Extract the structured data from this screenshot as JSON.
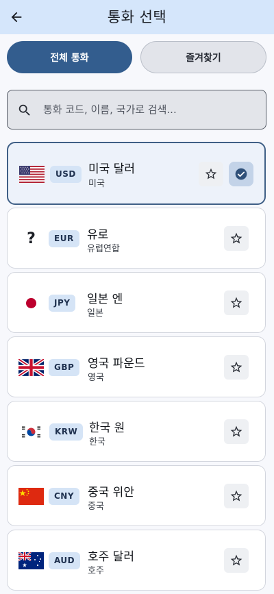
{
  "header": {
    "title": "통화 선택",
    "back_icon": "arrow-left-icon"
  },
  "tabs": [
    {
      "label": "전체 통화",
      "active": true
    },
    {
      "label": "즐겨찾기",
      "active": false
    }
  ],
  "search": {
    "placeholder": "통화 코드, 이름, 국가로 검색...",
    "value": "",
    "icon": "search-icon"
  },
  "currencies": [
    {
      "code": "USD",
      "name": "미국 달러",
      "country": "미국",
      "flag": "us-flag-icon",
      "selected": true,
      "favorite": false
    },
    {
      "code": "EUR",
      "name": "유로",
      "country": "유럽연합",
      "flag": "unknown-flag-icon",
      "flag_text": "?",
      "selected": false,
      "favorite": false
    },
    {
      "code": "JPY",
      "name": "일본 엔",
      "country": "일본",
      "flag": "jp-flag-icon",
      "selected": false,
      "favorite": false
    },
    {
      "code": "GBP",
      "name": "영국 파운드",
      "country": "영국",
      "flag": "uk-flag-icon",
      "selected": false,
      "favorite": false
    },
    {
      "code": "KRW",
      "name": "한국 원",
      "country": "한국",
      "flag": "kr-flag-icon",
      "selected": false,
      "favorite": false
    },
    {
      "code": "CNY",
      "name": "중국 위안",
      "country": "중국",
      "flag": "cn-flag-icon",
      "selected": false,
      "favorite": false
    },
    {
      "code": "AUD",
      "name": "호주 달러",
      "country": "호주",
      "flag": "au-flag-icon",
      "selected": false,
      "favorite": false
    }
  ],
  "colors": {
    "header_bg": "#d5e6fb",
    "accent": "#335d8e",
    "selected_border": "#3f5f86",
    "code_badge_bg": "#d5e4f6"
  }
}
